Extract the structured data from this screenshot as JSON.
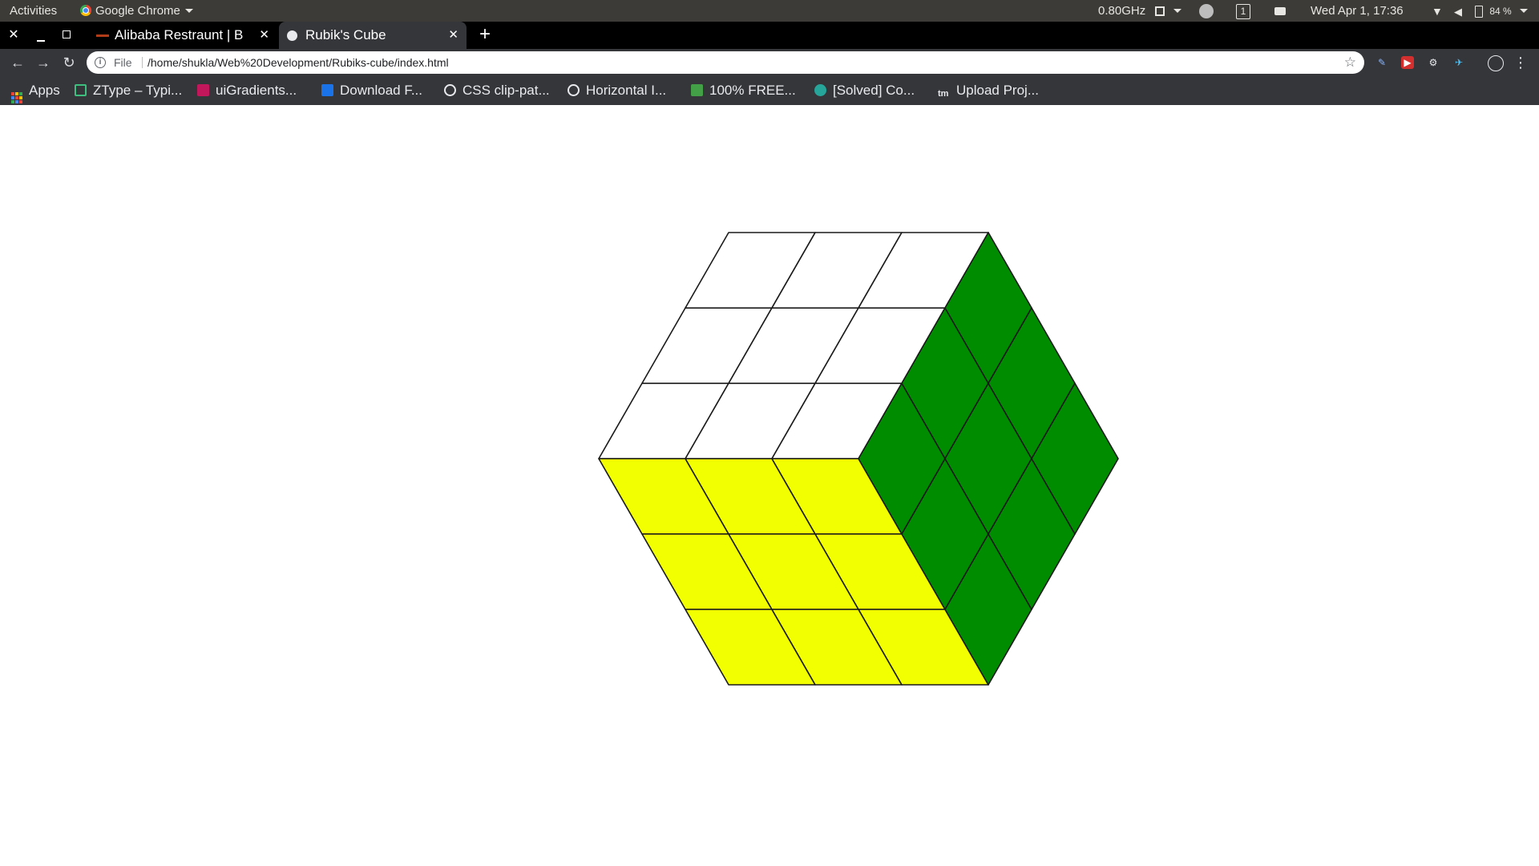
{
  "system_bar": {
    "activities": "Activities",
    "app_name": "Google Chrome",
    "cpu_freq": "0.80GHz",
    "workspace": "1",
    "clock": "Wed Apr  1, 17:36",
    "battery": "84 %"
  },
  "tabs": [
    {
      "title": "Alibaba Restraunt | Best",
      "active": false
    },
    {
      "title": "Rubik's Cube",
      "active": true
    }
  ],
  "address_bar": {
    "scheme_label": "File",
    "url": "/home/shukla/Web%20Development/Rubiks-cube/index.html"
  },
  "bookmarks": [
    {
      "label": "Apps",
      "icon": "apps-grid-icon"
    },
    {
      "label": "ZType – Typi...",
      "icon": "ztype-icon",
      "color": "#3fbf7f"
    },
    {
      "label": "uiGradients...",
      "icon": "uigradients-icon",
      "color": "#c2185b"
    },
    {
      "label": "Download F...",
      "icon": "download-icon",
      "color": "#1a73e8"
    },
    {
      "label": "CSS clip-pat...",
      "icon": "codepen-icon",
      "color": "#e8eaed"
    },
    {
      "label": "Horizontal I...",
      "icon": "codepen-icon",
      "color": "#e8eaed"
    },
    {
      "label": "100% FREE...",
      "icon": "udemy-icon",
      "color": "#43a047"
    },
    {
      "label": "[Solved] Co...",
      "icon": "solved-icon",
      "color": "#26a69a"
    },
    {
      "label": "Upload Proj...",
      "icon": "tm-icon",
      "color": "#e8eaed"
    }
  ],
  "cube": {
    "top_face": [
      "#ffffff",
      "#ffffff",
      "#ffffff",
      "#ffffff",
      "#ffffff",
      "#ffffff",
      "#ffffff",
      "#ffffff",
      "#ffffff"
    ],
    "front_face": [
      "#f2ff00",
      "#f2ff00",
      "#f2ff00",
      "#f2ff00",
      "#f2ff00",
      "#f2ff00",
      "#f2ff00",
      "#f2ff00",
      "#f2ff00"
    ],
    "right_face": [
      "#008c00",
      "#008c00",
      "#008c00",
      "#008c00",
      "#008c00",
      "#008c00",
      "#008c00",
      "#008c00",
      "#008c00"
    ],
    "stroke_color": "#1a1a1a"
  }
}
